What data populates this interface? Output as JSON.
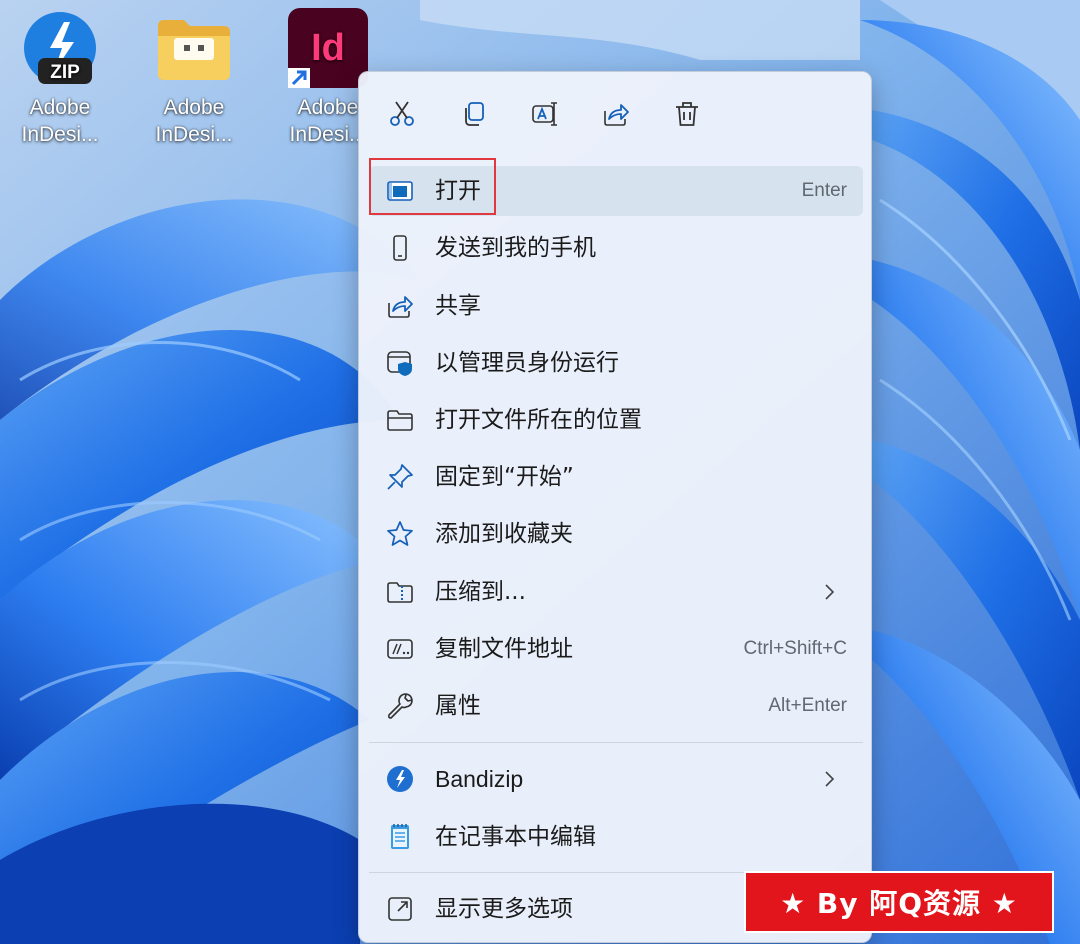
{
  "desktop": {
    "icons": [
      {
        "label_line1": "Adobe",
        "label_line2": "InDesi...",
        "icon": "bandizip-zip-icon"
      },
      {
        "label_line1": "Adobe",
        "label_line2": "InDesi...",
        "icon": "folder-icon"
      },
      {
        "label_line1": "Adobe",
        "label_line2": "InDesi...",
        "icon": "indesign-shortcut-icon",
        "logo_text": "Id"
      }
    ],
    "zip_logo_text": "ZIP"
  },
  "menu": {
    "toolbar": [
      {
        "icon": "cut-icon"
      },
      {
        "icon": "copy-icon"
      },
      {
        "icon": "rename-icon"
      },
      {
        "icon": "share-icon"
      },
      {
        "icon": "delete-icon"
      }
    ],
    "items": [
      {
        "label": "打开",
        "shortcut": "Enter",
        "icon": "open-app-icon",
        "highlighted": true
      },
      {
        "label": "发送到我的手机",
        "shortcut": "",
        "icon": "phone-icon"
      },
      {
        "label": "共享",
        "shortcut": "",
        "icon": "share-icon"
      },
      {
        "label": "以管理员身份运行",
        "shortcut": "",
        "icon": "shield-icon"
      },
      {
        "label": "打开文件所在的位置",
        "shortcut": "",
        "icon": "folder-icon"
      },
      {
        "label": "固定到“开始”",
        "shortcut": "",
        "icon": "pin-icon"
      },
      {
        "label": "添加到收藏夹",
        "shortcut": "",
        "icon": "star-icon"
      },
      {
        "label": "压缩到...",
        "shortcut": "",
        "icon": "zip-folder-icon",
        "submenu": true
      },
      {
        "label": "复制文件地址",
        "shortcut": "Ctrl+Shift+C",
        "icon": "copy-path-icon"
      },
      {
        "label": "属性",
        "shortcut": "Alt+Enter",
        "icon": "wrench-icon"
      },
      {
        "label": "Bandizip",
        "shortcut": "",
        "icon": "bandizip-icon",
        "submenu": true
      },
      {
        "label": "在记事本中编辑",
        "shortcut": "",
        "icon": "notepad-icon"
      },
      {
        "label": "显示更多选项",
        "shortcut": "",
        "icon": "more-options-icon"
      }
    ]
  },
  "watermark": {
    "text": "★ By 阿Q资源 ★"
  },
  "colors": {
    "accent": "#0f6cbd",
    "highlight_border": "#e0383e",
    "badge": "#e2141c"
  }
}
